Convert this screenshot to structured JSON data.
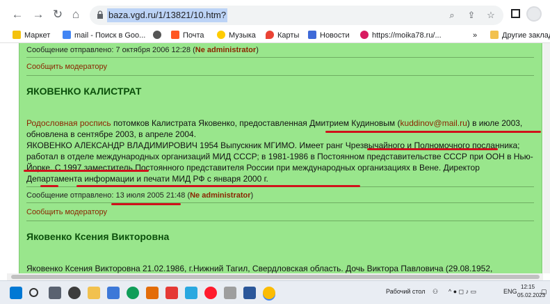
{
  "browser": {
    "url": "baza.vgd.ru/1/13821/10.htm?",
    "bookmarks": [
      {
        "label": "Маркет",
        "color": "#f4c20d"
      },
      {
        "label": "mail - Поиск в Goo...",
        "color": "#4285f4"
      },
      {
        "label": "",
        "color": "#555555"
      },
      {
        "label": "Почта",
        "color": "#ff5722"
      },
      {
        "label": "Музыка",
        "color": "#ffcc00"
      },
      {
        "label": "Карты",
        "color": "#ea4335"
      },
      {
        "label": "Новости",
        "color": "#3f6ad8"
      },
      {
        "label": "https://moika78.ru/...",
        "color": "#d81b60"
      },
      {
        "label": "Другие заклад",
        "color": "#f2c14e"
      }
    ],
    "more_label": "»"
  },
  "page": {
    "post1_meta_prefix": "Сообщение отправлено: 7 октября 2006 12:28 (",
    "post1_author": "Ne administrator",
    "post1_meta_suffix": ")",
    "report_label": "Сообщить модератору",
    "heading1": "ЯКОВЕНКО КАЛИСТРАТ",
    "p1_link": "Родословная роспись",
    "p1_text_a": " потомков Калистрата Яковенко, предоставленная Дмитрием Кудиновым (",
    "p1_email": "kuddinov@mail.ru",
    "p1_text_b": ") в июле 2003, обновлена в сентябре 2003, в апреле 2004.",
    "p1_line2": "ЯКОВЕНКО АЛЕКСАНДР ВЛАДИМИРОВИЧ 1954 Выпускник МГИМО. Имеет ранг Чрезвычайного и Полномочного посланника; работал в отделе международных организаций МИД СССР; в 1981-1986 в Постоянном представительстве СССР при ООН в Нью-Йорке. С 1997 заместитель Постоянного представителя России при международных организациях в Вене. Директор Департамента информации и печати МИД РФ с января 2000 г.",
    "post2_meta_prefix": "Сообщение отправлено: 13 июля 2005 21:48 (",
    "post2_author": "Ne administrator",
    "post2_meta_suffix": ")",
    "report_label2": "Сообщить модератору",
    "heading2": "Яковенко Ксения Викторовна",
    "p2_text": "Яковенко Ксения Викторовна 21.02.1986, г.Нижний Тагил, Свердловская область. Дочь Виктора Павловича (29.08.1952,"
  },
  "taskbar": {
    "desktop_label": "Рабочий стол",
    "lang": "ENG",
    "time": "12:15",
    "date": "05.02.2023"
  }
}
